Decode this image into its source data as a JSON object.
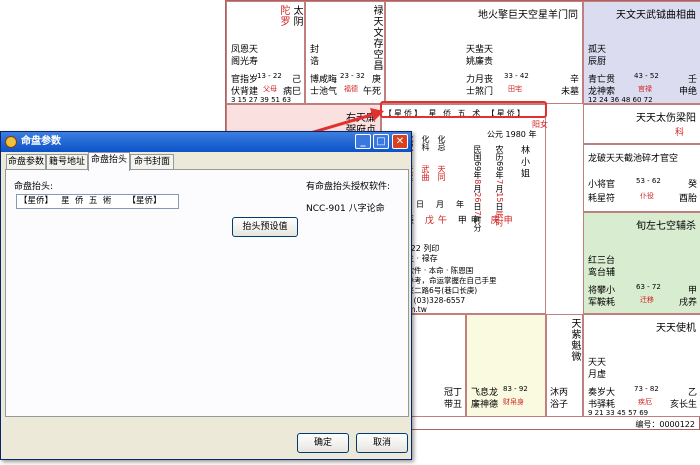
{
  "chart": {
    "cells": {
      "tl": {
        "stars_red": "陀罗",
        "stars": "太阴",
        "mid1": "凤恩天",
        "mid2": "阁光寿",
        "r1": "官指岁",
        "r2": "伏背建",
        "age": "13 - 22",
        "palace": "父母",
        "gz": "己",
        "gz2": "病巳",
        "nums": "3 15 27 39 51 63"
      },
      "t2": {
        "stars": "禄天文存空昌",
        "stars2": "天同太阴",
        "mid1": "封",
        "mid2": "诰",
        "r1": "博咸晦",
        "r2": "士池气",
        "age": "23 - 32",
        "palace": "福德",
        "gz": "庚",
        "gz2": "午死"
      },
      "t3": {
        "stars": "地火擎巨天空星羊门同",
        "mid1": "天蜚天",
        "mid2": "姚廉贵",
        "r1": "力月丧",
        "r2": "士煞门",
        "age": "33 - 42",
        "palace": "田宅",
        "gz": "辛",
        "gz2": "未墓"
      },
      "tr": {
        "stars": "天文天武钺曲相曲",
        "mid1": "孤天",
        "mid2": "辰厨",
        "r1": "青亡贯",
        "r2": "龙神索",
        "age": "43 - 52",
        "palace": "官禄",
        "gz": "壬",
        "gz2": "申绝",
        "nums": "12 24 36 48 60 72"
      },
      "r2": {
        "stars": "天天太伤梁阳",
        "palace": "科"
      },
      "r3": {
        "stars": "龙破天天截池碎才官空",
        "r1": "小将官",
        "r2": "耗星符",
        "age": "53 - 62",
        "palace": "仆役",
        "gz": "癸",
        "gz2": "酉胎"
      },
      "r4": {
        "stars": "旬左七空辅杀",
        "mid1": "红三台",
        "mid2": "鸾台辅",
        "r1": "将攀小",
        "r2": "军鞍耗",
        "age": "63 - 72",
        "palace": "迁移",
        "gz": "甲",
        "gz2": "戌养"
      },
      "br": {
        "stars": "天天使机",
        "mid1": "天天",
        "mid2": "月虚",
        "r1": "奏岁大",
        "r2": "书驿耗",
        "age": "73 - 82",
        "palace": "疾厄",
        "gz": "乙",
        "gz2": "亥长生",
        "nums": "9 21 33 45 57 69"
      },
      "b2": {
        "stars": "天紫魁微",
        "r1": "沐丙",
        "r2": "浴子"
      },
      "b3": {
        "stars": "飞息龙",
        "stars2": "廉神德",
        "age": "83 - 92",
        "palace": "财帛身"
      },
      "b4": {
        "r1": "冠丁",
        "r2": "带丑"
      },
      "l2": {
        "stars": "右天廉",
        "stars2": "弼府贞"
      }
    },
    "center": {
      "header": [
        "【星侨】",
        "星",
        "侨",
        "五",
        "术",
        "【星侨】"
      ],
      "gen": "公元 1980 年",
      "yin": "阳女",
      "cols": [
        "化禄",
        "化权",
        "化科",
        "化忌"
      ],
      "cols2": [
        "太阳",
        "天梁",
        "武曲",
        "天同"
      ],
      "year": [
        "民国",
        "69",
        "年",
        "8",
        "月",
        "26",
        "日",
        "7",
        "时",
        "分"
      ],
      "lunar": [
        "农历",
        "69",
        "年",
        "7",
        "月",
        "15",
        "日",
        "辰时"
      ],
      "name": "林 小 姐",
      "bazi_h": [
        "时",
        "日",
        "月",
        "年"
      ],
      "bazi": [
        "丙辰",
        "戊午",
        "甲申",
        "庚申"
      ],
      "bazi2": [
        "",
        "五局"
      ],
      "mingzhu": "命主",
      "extra": "95/8/22 列印",
      "extra2": "亡命主 · 禄存",
      "lines": [
        "侨易学软件 · 本命 · 陈恩国",
        "命仅供参考，命运掌握在自己手里",
        "山乡复兴二路6号(巷口长庚)",
        "3 传真：(03)328-6557",
        "ncc.com.tw"
      ]
    },
    "footer": "编号：0000122"
  },
  "dialog": {
    "title": "命盘参数",
    "tabs": [
      "命盘参数",
      "籍号地址",
      "命盘抬头",
      "命书封面"
    ],
    "field_label": "命盘抬头:",
    "field_value": "【星侨】   星  侨  五  術      【星侨】",
    "license_label": "有命盘抬头授权软件:",
    "license_value": "NCC-901 八字论命",
    "preview_button": "抬头预设值",
    "ok": "确定",
    "cancel": "取消",
    "min": "_",
    "max": "□",
    "close": "✕"
  },
  "colors": {
    "accent": "#e03030",
    "titlebar": "#0a52c8"
  }
}
